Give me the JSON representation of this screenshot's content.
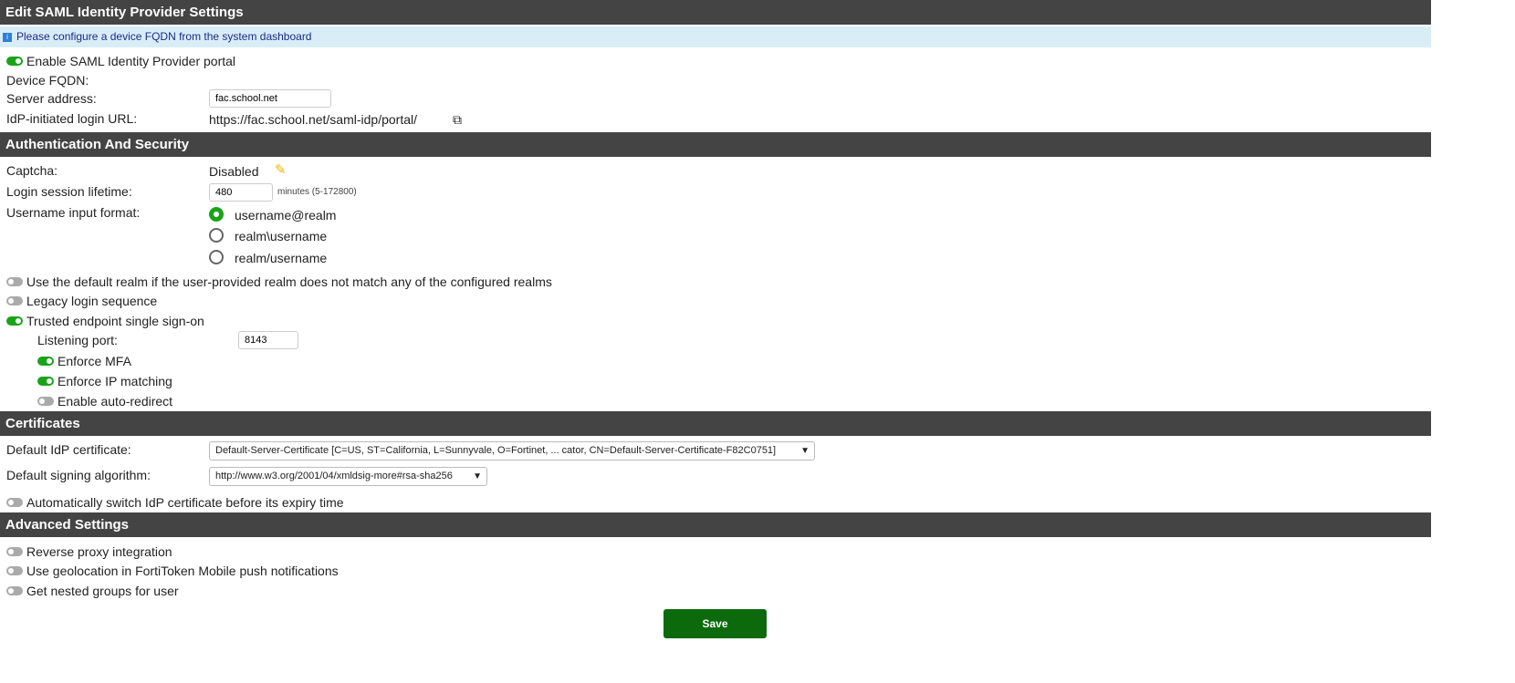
{
  "title": "Edit SAML Identity Provider Settings",
  "info": "Please configure a device FQDN from the system dashboard",
  "enable_portal": "Enable SAML Identity Provider portal",
  "device_fqdn": "Device FQDN:",
  "server_address_label": "Server address:",
  "server_address": "fac.school.net",
  "login_url_label": "IdP-initiated login URL:",
  "login_url": "https://fac.school.net/saml-idp/portal/",
  "auth": {
    "title": "Authentication And Security",
    "captcha_label": "Captcha:",
    "captcha": "Disabled",
    "lifetime_label": "Login session lifetime:",
    "lifetime": "480",
    "lifetime_hint": "minutes (5-172800)",
    "format_label": "Username input format:",
    "formats": [
      "username@realm",
      "realm\\username",
      "realm/username"
    ],
    "default_realm": "Use the default realm if the user-provided realm does not match any of the configured realms",
    "legacy": "Legacy login sequence",
    "trusted": "Trusted endpoint single sign-on",
    "port_label": "Listening port:",
    "port": "8143",
    "mfa": "Enforce MFA",
    "ip": "Enforce IP matching",
    "redirect": "Enable auto-redirect"
  },
  "certs": {
    "title": "Certificates",
    "cert_label": "Default IdP certificate:",
    "cert": "Default-Server-Certificate [C=US, ST=California, L=Sunnyvale, O=Fortinet, ... cator, CN=Default-Server-Certificate-F82C0751]",
    "alg_label": "Default signing algorithm:",
    "alg": "http://www.w3.org/2001/04/xmldsig-more#rsa-sha256",
    "auto_switch": "Automatically switch IdP certificate before its expiry time"
  },
  "advanced": {
    "title": "Advanced Settings",
    "proxy": "Reverse proxy integration",
    "geo": "Use geolocation in FortiToken Mobile push notifications",
    "nested": "Get nested groups for user"
  },
  "save": "Save"
}
